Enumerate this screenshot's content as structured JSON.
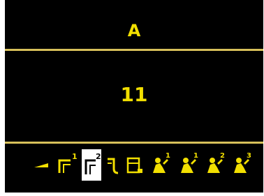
{
  "display": {
    "unit": "A",
    "value": "11"
  },
  "icons": [
    {
      "name": "ramp-icon",
      "selected": false
    },
    {
      "name": "bracket-step-1-icon",
      "selected": false,
      "badge": "1"
    },
    {
      "name": "bracket-step-2-icon",
      "selected": true,
      "badge": "2"
    },
    {
      "name": "hook-icon",
      "selected": false
    },
    {
      "name": "panel-icon",
      "selected": false
    },
    {
      "name": "operator-1-icon",
      "selected": false,
      "badge": "1"
    },
    {
      "name": "operator-2-icon",
      "selected": false,
      "badge": "1"
    },
    {
      "name": "operator-3-icon",
      "selected": false,
      "badge": "2"
    },
    {
      "name": "operator-4-icon",
      "selected": false,
      "badge": "3"
    }
  ],
  "colors": {
    "accent": "#f2df00",
    "divider": "#d7c05a",
    "background": "#000000",
    "selected_bg": "#ffffff"
  }
}
